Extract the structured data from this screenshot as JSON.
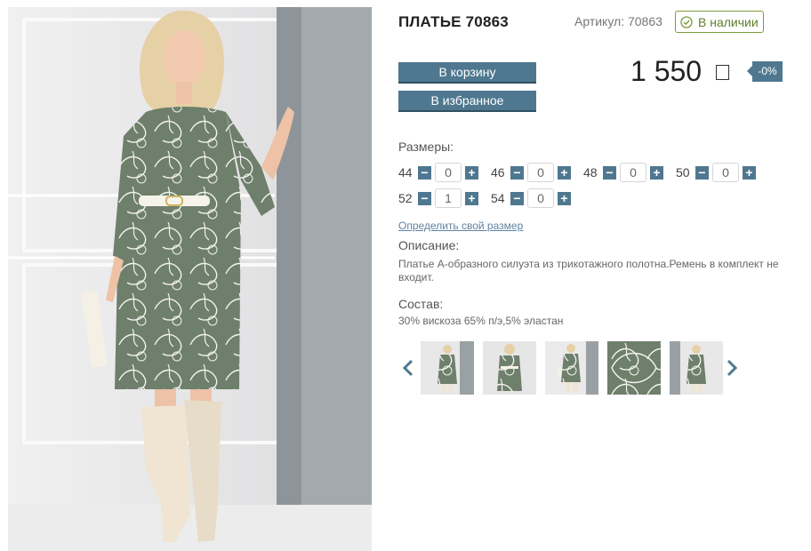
{
  "product": {
    "title": "ПЛАТЬЕ 70863",
    "article": "Артикул: 70863",
    "stock": "В наличии"
  },
  "buttons": {
    "cart": "В корзину",
    "favorite": "В избранное"
  },
  "price": {
    "value": "1 550",
    "discount": "-0%"
  },
  "sizes": {
    "label": "Размеры:",
    "items": [
      {
        "size": "44",
        "qty": "0"
      },
      {
        "size": "46",
        "qty": "0"
      },
      {
        "size": "48",
        "qty": "0"
      },
      {
        "size": "50",
        "qty": "0"
      },
      {
        "size": "52",
        "qty": "1"
      },
      {
        "size": "54",
        "qty": "0"
      }
    ],
    "minus": "−",
    "plus": "+",
    "link": "Определить свой размер"
  },
  "description": {
    "label": "Описание:",
    "text": "Платье А-образного силуэта из трикотажного полотна.Ремень в комплект не входит."
  },
  "composition": {
    "label": "Состав:",
    "text": "30% вискоза 65% п/э,5% эластан"
  },
  "gallery": {
    "thumb_count": 5
  },
  "colors": {
    "accent": "#4f7890",
    "stock_green": "#7c9a3a",
    "dress": "#6e7f6b",
    "link": "#5f83a0"
  }
}
